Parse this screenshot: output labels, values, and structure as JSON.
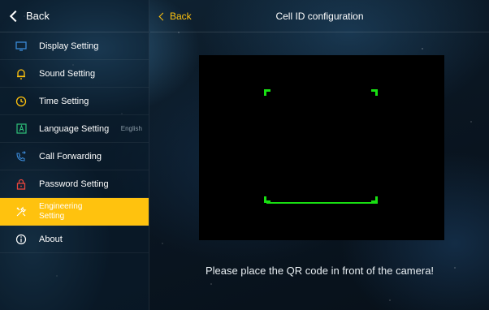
{
  "sidebar": {
    "back_label": "Back",
    "items": [
      {
        "label": "Display Setting",
        "icon": "monitor-icon",
        "sub": ""
      },
      {
        "label": "Sound Setting",
        "icon": "bell-icon",
        "sub": ""
      },
      {
        "label": "Time Setting",
        "icon": "clock-icon",
        "sub": ""
      },
      {
        "label": "Language Setting",
        "icon": "language-icon",
        "sub": "English"
      },
      {
        "label": "Call Forwarding",
        "icon": "phone-forward-icon",
        "sub": ""
      },
      {
        "label": "Password Setting",
        "icon": "lock-icon",
        "sub": ""
      },
      {
        "label": "Engineering Setting",
        "icon": "tools-icon",
        "sub": "",
        "active": true
      },
      {
        "label": "About",
        "icon": "info-icon",
        "sub": ""
      }
    ]
  },
  "header": {
    "back_label": "Back",
    "title": "Cell ID configuration"
  },
  "main": {
    "hint": "Please place the QR code in front of the camera!"
  },
  "colors": {
    "accent": "#ffc20e",
    "scanner": "#18e012",
    "icon_green": "#2fc27a",
    "icon_red": "#e8453c",
    "icon_yellow": "#ffc20e",
    "icon_blue": "#3b8ad8"
  }
}
